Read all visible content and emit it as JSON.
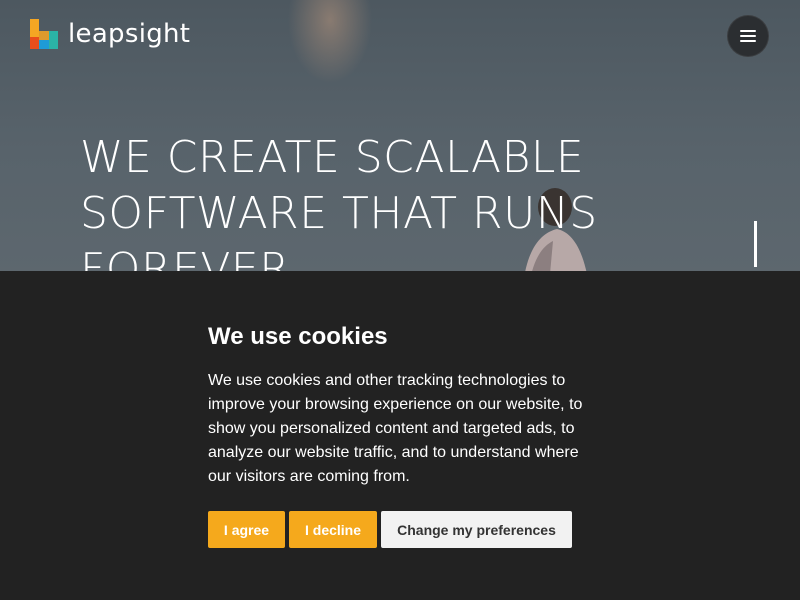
{
  "header": {
    "logo_text": "leapsight",
    "menu_icon": "hamburger-menu-icon"
  },
  "hero": {
    "headline_lines": [
      "WE CREATE SCALABLE",
      "SOFTWARE THAT RUNS",
      "FOREVER"
    ]
  },
  "cookie_banner": {
    "title": "We use cookies",
    "text": "We use cookies and other tracking technologies to improve your browsing experience on our website, to show you personalized content and targeted ads, to analyze our website traffic, and to understand where our visitors are coming from.",
    "buttons": {
      "agree": "I agree",
      "decline": "I decline",
      "preferences": "Change my preferences"
    }
  },
  "colors": {
    "accent": "#f5a91c",
    "banner_bg": "#222222",
    "logo_orange": "#f5a623",
    "logo_blue": "#1e9bd7",
    "logo_red": "#e94e1b",
    "logo_green": "#2bb3a6"
  }
}
